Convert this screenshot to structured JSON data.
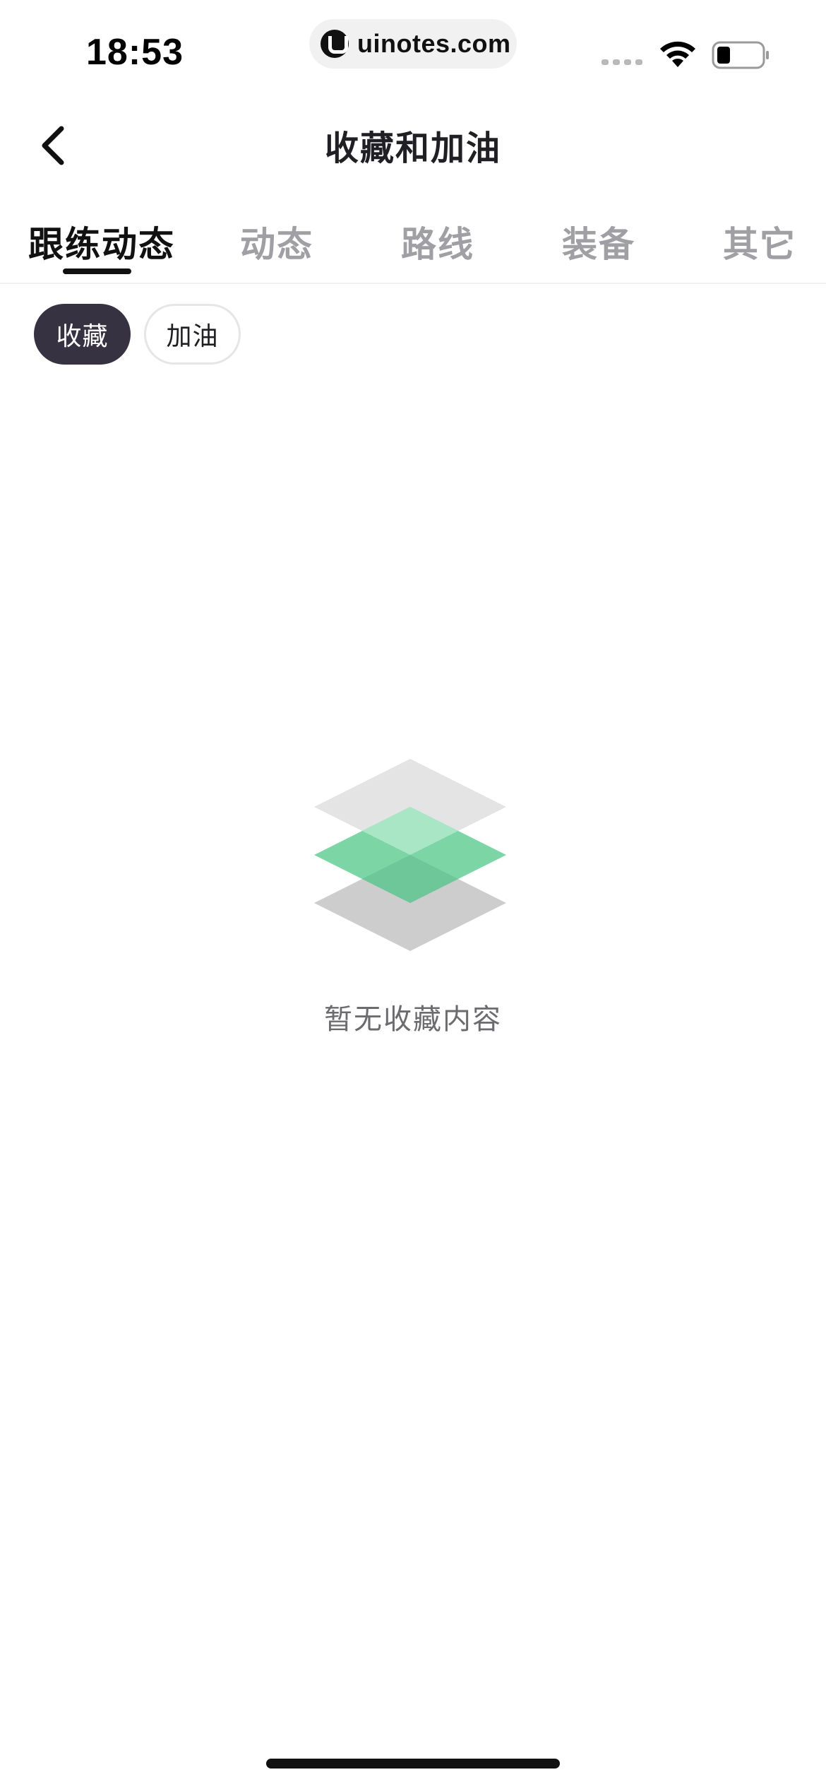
{
  "status_bar": {
    "time": "18:53",
    "url": "uinotes.com"
  },
  "header": {
    "title": "收藏和加油"
  },
  "tabs": [
    {
      "label": "跟练动态",
      "active": true
    },
    {
      "label": "动态",
      "active": false
    },
    {
      "label": "路线",
      "active": false
    },
    {
      "label": "装备",
      "active": false
    },
    {
      "label": "其它",
      "active": false
    }
  ],
  "filters": [
    {
      "label": "收藏",
      "selected": true
    },
    {
      "label": "加油",
      "selected": false
    }
  ],
  "empty_state": {
    "message": "暂无收藏内容",
    "icon": "stacked-layers-icon"
  },
  "colors": {
    "accent_green": "#6fd19d",
    "chip_active_bg": "#363241",
    "tab_inactive": "#a0a0a4"
  }
}
